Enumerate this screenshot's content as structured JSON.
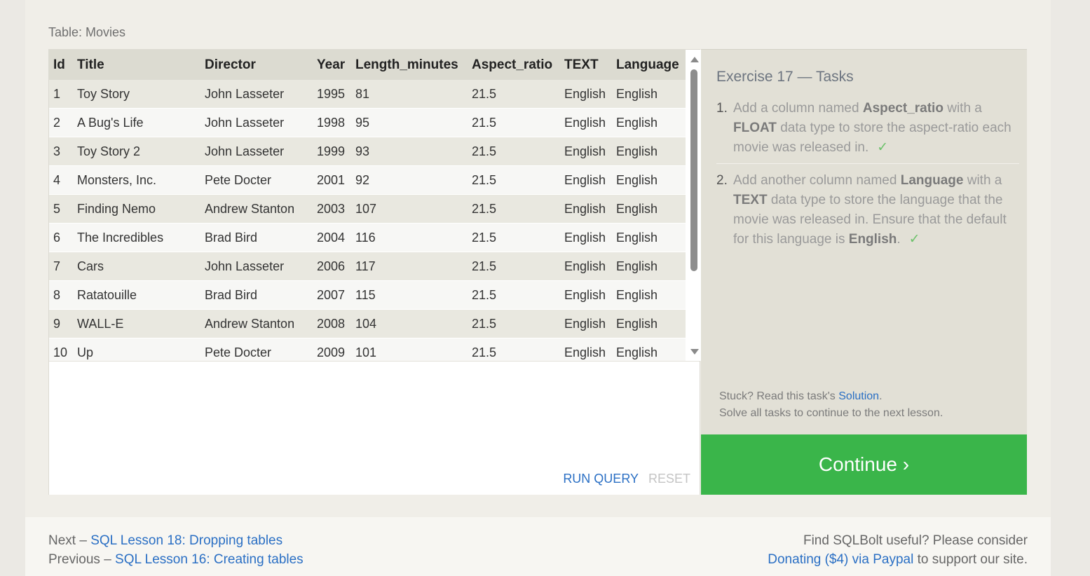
{
  "table": {
    "caption": "Table: Movies",
    "columns": [
      "Id",
      "Title",
      "Director",
      "Year",
      "Length_minutes",
      "Aspect_ratio",
      "TEXT",
      "Language"
    ],
    "rows": [
      [
        "1",
        "Toy Story",
        "John Lasseter",
        "1995",
        "81",
        "21.5",
        "English",
        "English"
      ],
      [
        "2",
        "A Bug's Life",
        "John Lasseter",
        "1998",
        "95",
        "21.5",
        "English",
        "English"
      ],
      [
        "3",
        "Toy Story 2",
        "John Lasseter",
        "1999",
        "93",
        "21.5",
        "English",
        "English"
      ],
      [
        "4",
        "Monsters, Inc.",
        "Pete Docter",
        "2001",
        "92",
        "21.5",
        "English",
        "English"
      ],
      [
        "5",
        "Finding Nemo",
        "Andrew Stanton",
        "2003",
        "107",
        "21.5",
        "English",
        "English"
      ],
      [
        "6",
        "The Incredibles",
        "Brad Bird",
        "2004",
        "116",
        "21.5",
        "English",
        "English"
      ],
      [
        "7",
        "Cars",
        "John Lasseter",
        "2006",
        "117",
        "21.5",
        "English",
        "English"
      ],
      [
        "8",
        "Ratatouille",
        "Brad Bird",
        "2007",
        "115",
        "21.5",
        "English",
        "English"
      ],
      [
        "9",
        "WALL-E",
        "Andrew Stanton",
        "2008",
        "104",
        "21.5",
        "English",
        "English"
      ],
      [
        "10",
        "Up",
        "Pete Docter",
        "2009",
        "101",
        "21.5",
        "English",
        "English"
      ]
    ]
  },
  "query": {
    "run_label": "RUN QUERY",
    "reset_label": "RESET"
  },
  "tasks": {
    "title": "Exercise 17 — Tasks",
    "items": [
      {
        "num": "1.",
        "p1": "Add a column named ",
        "b1": "Aspect_ratio",
        "p2": " with a ",
        "b2": "FLOAT",
        "p3": " data type to store the aspect-ratio each movie was released in.",
        "b3": "",
        "p4": "",
        "check": "✓"
      },
      {
        "num": "2.",
        "p1": "Add another column named ",
        "b1": "Language",
        "p2": " with a ",
        "b2": "TEXT",
        "p3": " data type to store the language that the movie was released in. Ensure that the default for this language is ",
        "b3": "English",
        "p4": ".",
        "check": "✓"
      }
    ],
    "hint_prefix": "Stuck? Read this task's ",
    "hint_link": "Solution",
    "hint_suffix": ".",
    "hint_line2": "Solve all tasks to continue to the next lesson.",
    "continue_label": "Continue ›"
  },
  "footer": {
    "next_prefix": "Next – ",
    "next_link": "SQL Lesson 18: Dropping tables",
    "prev_prefix": "Previous – ",
    "prev_link": "SQL Lesson 16: Creating tables",
    "support_line1": "Find SQLBolt useful? Please consider",
    "donate_link": "Donating ($4) via Paypal",
    "support_suffix": " to support our site."
  },
  "colors": {
    "accent_green": "#3ab54a",
    "link_blue": "#2a6fc4",
    "check_green": "#6cc16a"
  }
}
